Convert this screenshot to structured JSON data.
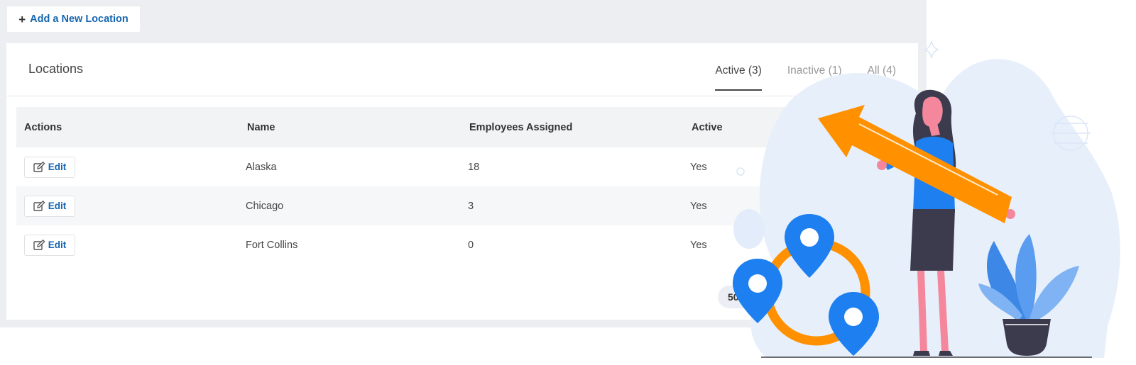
{
  "toolbar": {
    "add_label": "Add a New Location",
    "add_icon": "plus-icon"
  },
  "card": {
    "title": "Locations",
    "tabs": [
      {
        "label": "Active (3)",
        "active": true
      },
      {
        "label": "Inactive (1)",
        "active": false
      },
      {
        "label": "All (4)",
        "active": false
      }
    ]
  },
  "table": {
    "headers": [
      "Actions",
      "Name",
      "Employees Assigned",
      "Active"
    ],
    "rows": [
      {
        "action": "Edit",
        "name": "Alaska",
        "employees": "18",
        "active": "Yes"
      },
      {
        "action": "Edit",
        "name": "Chicago",
        "employees": "3",
        "active": "Yes"
      },
      {
        "action": "Edit",
        "name": "Fort Collins",
        "employees": "0",
        "active": "Yes"
      }
    ],
    "edit_icon": "edit-icon"
  },
  "pager": {
    "page_size": "50"
  },
  "colors": {
    "accent": "#1565b0",
    "page_bg": "#eceef1",
    "arrow": "#ff9100",
    "pin": "#1e7ff0",
    "blob": "#e7effb"
  }
}
